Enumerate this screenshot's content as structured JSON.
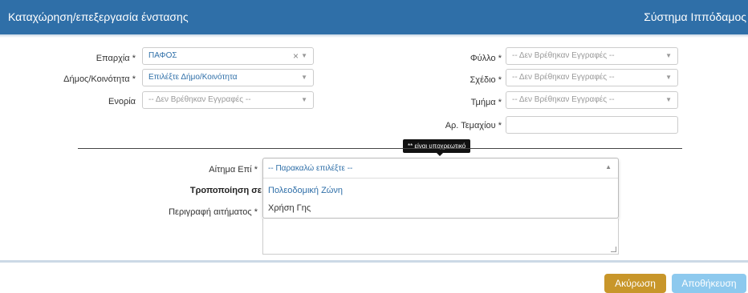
{
  "header": {
    "title": "Καταχώρηση/επεξεργασία ένστασης",
    "system": "Σύστημα Ιππόδαμος"
  },
  "left_fields": {
    "province_label": "Επαρχία *",
    "province_value": "ΠΑΦΟΣ",
    "municipality_label": "Δήμος/Κοινότητα *",
    "municipality_value": "Επιλέξτε Δήμο/Κοινότητα",
    "parish_label": "Ενορία",
    "parish_value": "-- Δεν Βρέθηκαν Εγγραφές --"
  },
  "right_fields": {
    "sheet_label": "Φύλλο *",
    "sheet_value": "-- Δεν Βρέθηκαν Εγγραφές --",
    "plan_label": "Σχέδιο *",
    "plan_value": "-- Δεν Βρέθηκαν Εγγραφές --",
    "section_label": "Τμήμα *",
    "section_value": "-- Δεν Βρέθηκαν Εγγραφές --",
    "plot_label": "Αρ. Τεμαχίου *",
    "plot_value": ""
  },
  "tooltip": "** είναι υποχρεωτικό",
  "request": {
    "request_on_label": "Αίτημα Επί *",
    "request_on_placeholder": "-- Παρακαλώ επιλέξτε --",
    "options": [
      "Πολεοδομική Ζώνη",
      "Χρήση Γης"
    ],
    "modification_label": "Τροποποίηση σε",
    "description_label": "Περιγραφή αιτήματος *"
  },
  "buttons": {
    "cancel": "Ακύρωση",
    "save": "Αποθήκευση"
  },
  "colors": {
    "header": "#2f6fa8",
    "cancel": "#c8962a",
    "save": "#8dc9ee"
  }
}
